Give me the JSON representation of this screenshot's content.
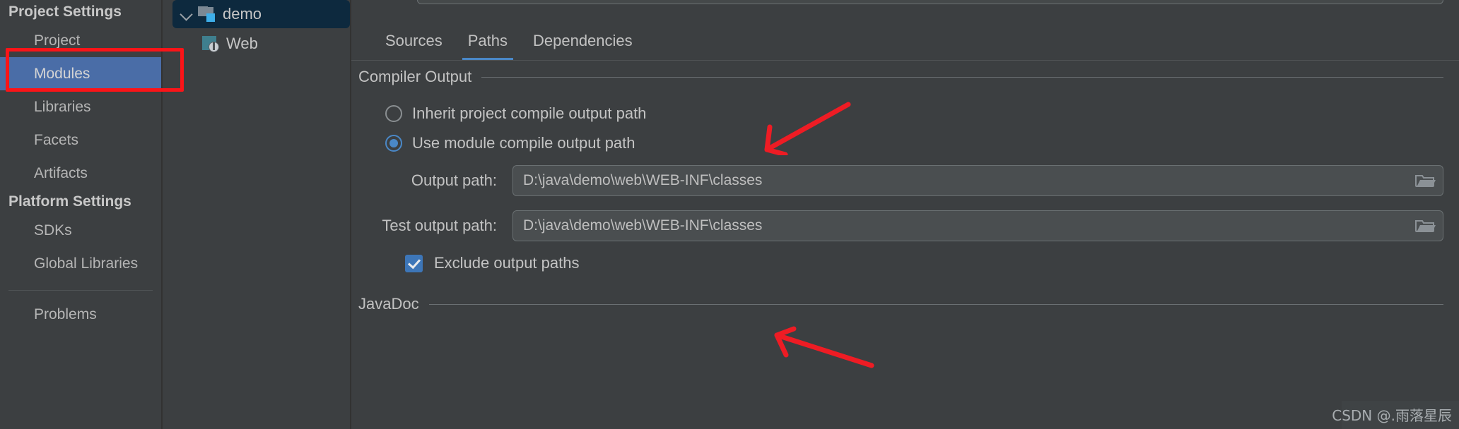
{
  "sidebar": {
    "groups": [
      {
        "title": "Project Settings",
        "items": [
          {
            "label": "Project",
            "selected": false
          },
          {
            "label": "Modules",
            "selected": true
          },
          {
            "label": "Libraries",
            "selected": false
          },
          {
            "label": "Facets",
            "selected": false
          },
          {
            "label": "Artifacts",
            "selected": false
          }
        ]
      },
      {
        "title": "Platform Settings",
        "items": [
          {
            "label": "SDKs",
            "selected": false
          },
          {
            "label": "Global Libraries",
            "selected": false
          }
        ]
      }
    ],
    "footer_items": [
      {
        "label": "Problems",
        "selected": false
      }
    ]
  },
  "tree": {
    "module": {
      "label": "demo",
      "icon": "module-icon",
      "chevron": "chevron-down-icon",
      "expanded": true,
      "selected": true
    },
    "facet": {
      "label": "Web",
      "icon": "web-facet-icon"
    }
  },
  "tabs": [
    {
      "label": "Sources",
      "active": false
    },
    {
      "label": "Paths",
      "active": true
    },
    {
      "label": "Dependencies",
      "active": false
    }
  ],
  "compiler_output": {
    "section_label": "Compiler Output",
    "radios": [
      {
        "label": "Inherit project compile output path",
        "checked": false
      },
      {
        "label": "Use module compile output path",
        "checked": true
      }
    ],
    "fields": [
      {
        "label": "Output path:",
        "value": "D:\\java\\demo\\web\\WEB-INF\\classes",
        "browse_icon": "folder-icon"
      },
      {
        "label": "Test output path:",
        "value": "D:\\java\\demo\\web\\WEB-INF\\classes",
        "browse_icon": "folder-icon"
      }
    ],
    "checkbox": {
      "label": "Exclude output paths",
      "checked": true
    }
  },
  "javadoc": {
    "section_label": "JavaDoc"
  },
  "watermark": {
    "text": "CSDN @.雨落星辰"
  },
  "annotations": {
    "highlight_rect": "red-rectangle-around-modules",
    "arrow_one": "red-arrow-pointing-to-use-module-compile-output-path",
    "arrow_two": "red-arrow-pointing-to-exclude-output-paths"
  },
  "colors": {
    "background": "#3c3f41",
    "selection_blue": "#4a6da7",
    "tree_selection": "#0d293e",
    "accent_blue": "#4a88c7",
    "annotation_red": "#fb1418",
    "text": "#c2c2c2"
  }
}
